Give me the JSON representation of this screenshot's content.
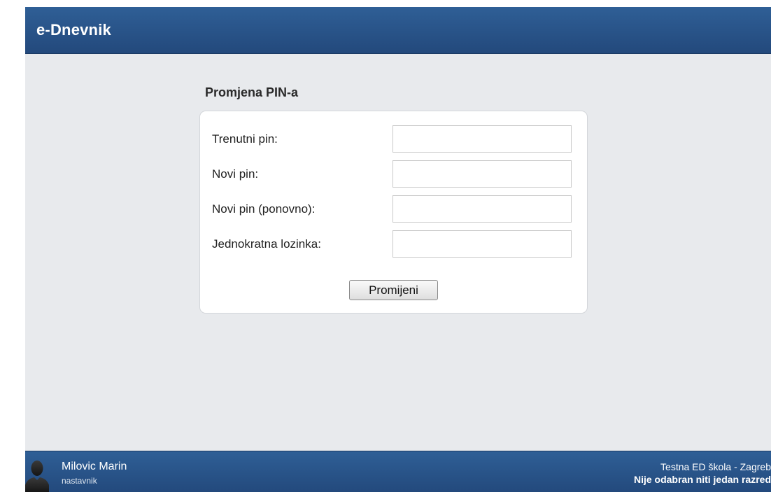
{
  "header": {
    "title": "e-Dnevnik"
  },
  "form": {
    "title": "Promjena PIN-a",
    "fields": [
      {
        "label": "Trenutni pin:",
        "value": ""
      },
      {
        "label": "Novi pin:",
        "value": ""
      },
      {
        "label": "Novi pin (ponovno):",
        "value": ""
      },
      {
        "label": "Jednokratna lozinka:",
        "value": ""
      }
    ],
    "submit_label": "Promijeni"
  },
  "footer": {
    "avatar_icon": "user-silhouette-icon",
    "user_name": "Milovic Marin",
    "user_role": "nastavnik",
    "school": "Testna ED škola - Zagreb",
    "class_status": "Nije odabran niti jedan razred"
  },
  "colors": {
    "header_bg": "#2a548a",
    "page_bg": "#e8eaed",
    "panel_bg": "#ffffff"
  }
}
